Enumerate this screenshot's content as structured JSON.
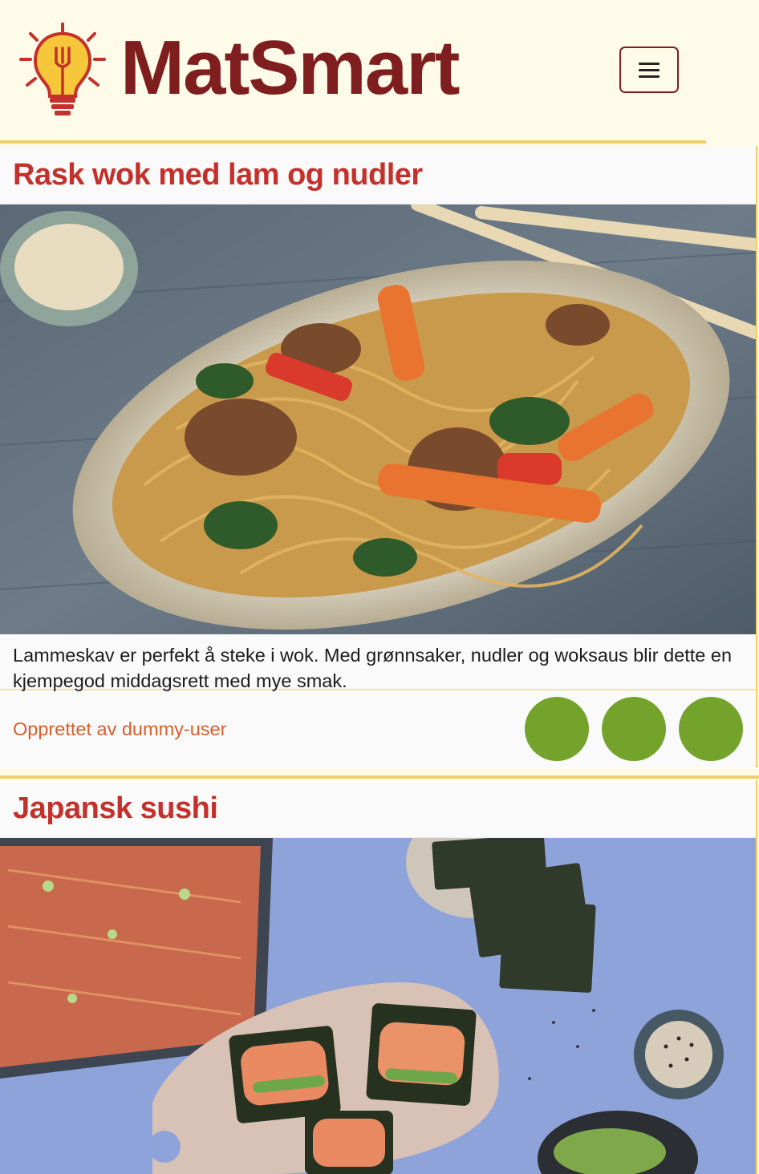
{
  "brand": {
    "name": "MatSmart",
    "logo_icon": "lightbulb-fork-icon"
  },
  "header": {
    "menu_icon": "hamburger-icon",
    "menu_label": "Menu"
  },
  "colors": {
    "brand_dark": "#7f1e1e",
    "title_red": "#c4302b",
    "creator_orange": "#d75f2b",
    "action_green": "#73a32b",
    "accent_yellow": "#f0cf6a"
  },
  "recipes": [
    {
      "title": "Rask wok med lam og nudler",
      "description": "Lammeskav er perfekt å steke i wok. Med grønnsaker, nudler og woksaus blir dette en kjempegod middagsrett med mye smak.",
      "creator": "Opprettet av dummy-user",
      "image": "photo of lamb stir-fry with noodles in a bowl"
    },
    {
      "title": "Japansk sushi",
      "image": "photo of sushi bake with nori sheets"
    }
  ]
}
